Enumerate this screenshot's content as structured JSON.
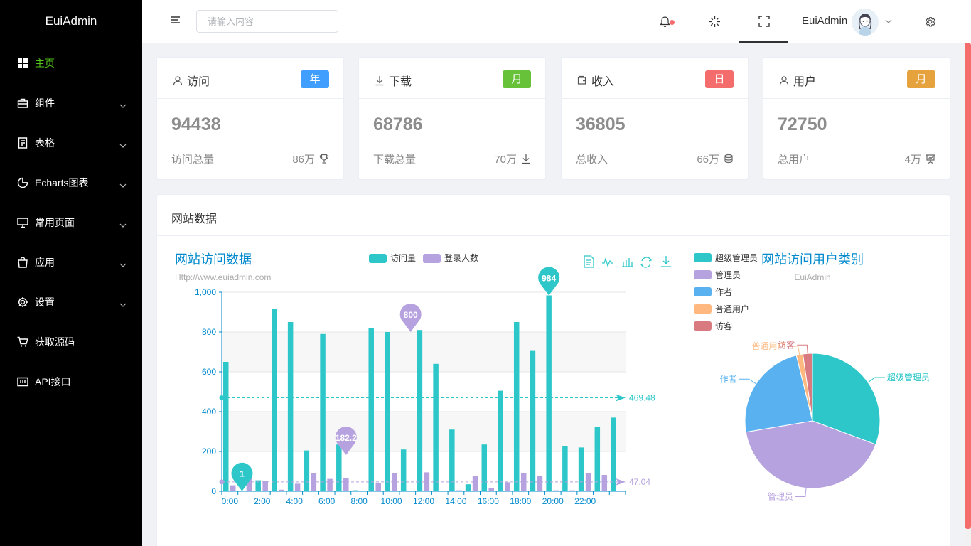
{
  "app": {
    "title": "EuiAdmin"
  },
  "sidebar": {
    "items": [
      {
        "label": "主页",
        "icon": "grid-icon",
        "active": true,
        "arrow": false
      },
      {
        "label": "组件",
        "icon": "briefcase-icon",
        "active": false,
        "arrow": true
      },
      {
        "label": "表格",
        "icon": "document-icon",
        "active": false,
        "arrow": true
      },
      {
        "label": "Echarts图表",
        "icon": "pie-chart-icon",
        "active": false,
        "arrow": true
      },
      {
        "label": "常用页面",
        "icon": "monitor-icon",
        "active": false,
        "arrow": true
      },
      {
        "label": "应用",
        "icon": "shopping-bag-icon",
        "active": false,
        "arrow": true
      },
      {
        "label": "设置",
        "icon": "gear-icon",
        "active": false,
        "arrow": true
      },
      {
        "label": "获取源码",
        "icon": "cart-icon",
        "active": false,
        "arrow": false
      },
      {
        "label": "API接口",
        "icon": "api-icon",
        "active": false,
        "arrow": false
      }
    ]
  },
  "header": {
    "search_placeholder": "请输入内容",
    "user_name": "EuiAdmin"
  },
  "cards": [
    {
      "title": "访问",
      "badge": "年",
      "badge_color": "#409eff",
      "value": "94438",
      "label": "访问总量",
      "total": "86万",
      "icon": "user-icon",
      "total_icon": "trophy-icon"
    },
    {
      "title": "下载",
      "badge": "月",
      "badge_color": "#67c23a",
      "value": "68786",
      "label": "下载总量",
      "total": "70万",
      "icon": "download-icon",
      "total_icon": "download-icon"
    },
    {
      "title": "收入",
      "badge": "日",
      "badge_color": "#f56c6c",
      "value": "36805",
      "label": "总收入",
      "total": "66万",
      "icon": "wallet-icon",
      "total_icon": "coins-icon"
    },
    {
      "title": "用户",
      "badge": "月",
      "badge_color": "#e6a23c",
      "value": "72750",
      "label": "总用户",
      "total": "4万",
      "icon": "user-icon",
      "total_icon": "presentation-icon"
    }
  ],
  "panel": {
    "title": "网站数据"
  },
  "chart_data": [
    {
      "type": "bar",
      "title": "网站访问数据",
      "subtitle": "Http://www.euiadmin.com",
      "legend_position": "top",
      "grid": true,
      "ylim": [
        0,
        1000
      ],
      "y_ticks": [
        "0",
        "200",
        "400",
        "600",
        "800",
        "1,000"
      ],
      "x_tick_labels": [
        "0:00",
        "2:00",
        "4:00",
        "6:00",
        "8:00",
        "10:00",
        "12:00",
        "14:00",
        "16:00",
        "18:00",
        "20:00",
        "22:00"
      ],
      "series": [
        {
          "name": "访问量",
          "color": "#2ec7c9",
          "values": [
            650,
            1,
            55,
            915,
            850,
            205,
            790,
            235,
            5,
            820,
            800,
            210,
            810,
            640,
            310,
            35,
            235,
            505,
            850,
            705,
            984,
            225,
            220,
            325,
            370
          ],
          "mark_points": [
            {
              "label": "984",
              "index": 20
            },
            {
              "label": "1",
              "index": 1
            }
          ],
          "average": "469.48"
        },
        {
          "name": "登录人数",
          "color": "#b6a2de",
          "values": [
            30,
            65,
            52,
            8,
            38,
            92,
            62,
            68,
            2,
            40,
            92,
            3,
            95,
            2,
            5,
            75,
            15,
            45,
            90,
            78,
            5,
            5,
            90,
            82,
            0
          ],
          "mark_points": [
            {
              "label": "182.2",
              "index": 7
            },
            {
              "label": "800",
              "index": 11
            }
          ],
          "average": "47.04"
        }
      ]
    },
    {
      "type": "pie",
      "title": "网站访问用户类别",
      "subtitle": "EuiAdmin",
      "legend_position": "top-left",
      "slices": [
        {
          "name": "超级管理员",
          "value": 335,
          "color": "#2ec7c9"
        },
        {
          "name": "管理员",
          "value": 455,
          "color": "#b6a2de"
        },
        {
          "name": "作者",
          "value": 260,
          "color": "#5ab1ef"
        },
        {
          "name": "普通用户",
          "value": 17,
          "color": "#ffb980"
        },
        {
          "name": "访客",
          "value": 25,
          "color": "#d87a80"
        }
      ]
    }
  ]
}
